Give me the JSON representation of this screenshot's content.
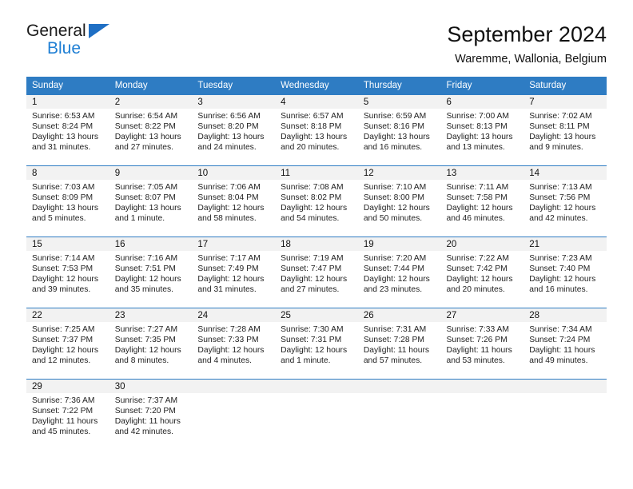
{
  "brand": {
    "name_top": "General",
    "name_bottom": "Blue",
    "accent_color": "#1f7fd4"
  },
  "header": {
    "title": "September 2024",
    "subtitle": "Waremme, Wallonia, Belgium"
  },
  "theme": {
    "header_bg": "#2e7cc3",
    "daynum_bg": "#f2f2f2",
    "text": "#222222"
  },
  "calendar": {
    "weekday_headers": [
      "Sunday",
      "Monday",
      "Tuesday",
      "Wednesday",
      "Thursday",
      "Friday",
      "Saturday"
    ],
    "weeks": [
      [
        {
          "day": "1",
          "sunrise": "Sunrise: 6:53 AM",
          "sunset": "Sunset: 8:24 PM",
          "daylight1": "Daylight: 13 hours",
          "daylight2": "and 31 minutes."
        },
        {
          "day": "2",
          "sunrise": "Sunrise: 6:54 AM",
          "sunset": "Sunset: 8:22 PM",
          "daylight1": "Daylight: 13 hours",
          "daylight2": "and 27 minutes."
        },
        {
          "day": "3",
          "sunrise": "Sunrise: 6:56 AM",
          "sunset": "Sunset: 8:20 PM",
          "daylight1": "Daylight: 13 hours",
          "daylight2": "and 24 minutes."
        },
        {
          "day": "4",
          "sunrise": "Sunrise: 6:57 AM",
          "sunset": "Sunset: 8:18 PM",
          "daylight1": "Daylight: 13 hours",
          "daylight2": "and 20 minutes."
        },
        {
          "day": "5",
          "sunrise": "Sunrise: 6:59 AM",
          "sunset": "Sunset: 8:16 PM",
          "daylight1": "Daylight: 13 hours",
          "daylight2": "and 16 minutes."
        },
        {
          "day": "6",
          "sunrise": "Sunrise: 7:00 AM",
          "sunset": "Sunset: 8:13 PM",
          "daylight1": "Daylight: 13 hours",
          "daylight2": "and 13 minutes."
        },
        {
          "day": "7",
          "sunrise": "Sunrise: 7:02 AM",
          "sunset": "Sunset: 8:11 PM",
          "daylight1": "Daylight: 13 hours",
          "daylight2": "and 9 minutes."
        }
      ],
      [
        {
          "day": "8",
          "sunrise": "Sunrise: 7:03 AM",
          "sunset": "Sunset: 8:09 PM",
          "daylight1": "Daylight: 13 hours",
          "daylight2": "and 5 minutes."
        },
        {
          "day": "9",
          "sunrise": "Sunrise: 7:05 AM",
          "sunset": "Sunset: 8:07 PM",
          "daylight1": "Daylight: 13 hours",
          "daylight2": "and 1 minute."
        },
        {
          "day": "10",
          "sunrise": "Sunrise: 7:06 AM",
          "sunset": "Sunset: 8:04 PM",
          "daylight1": "Daylight: 12 hours",
          "daylight2": "and 58 minutes."
        },
        {
          "day": "11",
          "sunrise": "Sunrise: 7:08 AM",
          "sunset": "Sunset: 8:02 PM",
          "daylight1": "Daylight: 12 hours",
          "daylight2": "and 54 minutes."
        },
        {
          "day": "12",
          "sunrise": "Sunrise: 7:10 AM",
          "sunset": "Sunset: 8:00 PM",
          "daylight1": "Daylight: 12 hours",
          "daylight2": "and 50 minutes."
        },
        {
          "day": "13",
          "sunrise": "Sunrise: 7:11 AM",
          "sunset": "Sunset: 7:58 PM",
          "daylight1": "Daylight: 12 hours",
          "daylight2": "and 46 minutes."
        },
        {
          "day": "14",
          "sunrise": "Sunrise: 7:13 AM",
          "sunset": "Sunset: 7:56 PM",
          "daylight1": "Daylight: 12 hours",
          "daylight2": "and 42 minutes."
        }
      ],
      [
        {
          "day": "15",
          "sunrise": "Sunrise: 7:14 AM",
          "sunset": "Sunset: 7:53 PM",
          "daylight1": "Daylight: 12 hours",
          "daylight2": "and 39 minutes."
        },
        {
          "day": "16",
          "sunrise": "Sunrise: 7:16 AM",
          "sunset": "Sunset: 7:51 PM",
          "daylight1": "Daylight: 12 hours",
          "daylight2": "and 35 minutes."
        },
        {
          "day": "17",
          "sunrise": "Sunrise: 7:17 AM",
          "sunset": "Sunset: 7:49 PM",
          "daylight1": "Daylight: 12 hours",
          "daylight2": "and 31 minutes."
        },
        {
          "day": "18",
          "sunrise": "Sunrise: 7:19 AM",
          "sunset": "Sunset: 7:47 PM",
          "daylight1": "Daylight: 12 hours",
          "daylight2": "and 27 minutes."
        },
        {
          "day": "19",
          "sunrise": "Sunrise: 7:20 AM",
          "sunset": "Sunset: 7:44 PM",
          "daylight1": "Daylight: 12 hours",
          "daylight2": "and 23 minutes."
        },
        {
          "day": "20",
          "sunrise": "Sunrise: 7:22 AM",
          "sunset": "Sunset: 7:42 PM",
          "daylight1": "Daylight: 12 hours",
          "daylight2": "and 20 minutes."
        },
        {
          "day": "21",
          "sunrise": "Sunrise: 7:23 AM",
          "sunset": "Sunset: 7:40 PM",
          "daylight1": "Daylight: 12 hours",
          "daylight2": "and 16 minutes."
        }
      ],
      [
        {
          "day": "22",
          "sunrise": "Sunrise: 7:25 AM",
          "sunset": "Sunset: 7:37 PM",
          "daylight1": "Daylight: 12 hours",
          "daylight2": "and 12 minutes."
        },
        {
          "day": "23",
          "sunrise": "Sunrise: 7:27 AM",
          "sunset": "Sunset: 7:35 PM",
          "daylight1": "Daylight: 12 hours",
          "daylight2": "and 8 minutes."
        },
        {
          "day": "24",
          "sunrise": "Sunrise: 7:28 AM",
          "sunset": "Sunset: 7:33 PM",
          "daylight1": "Daylight: 12 hours",
          "daylight2": "and 4 minutes."
        },
        {
          "day": "25",
          "sunrise": "Sunrise: 7:30 AM",
          "sunset": "Sunset: 7:31 PM",
          "daylight1": "Daylight: 12 hours",
          "daylight2": "and 1 minute."
        },
        {
          "day": "26",
          "sunrise": "Sunrise: 7:31 AM",
          "sunset": "Sunset: 7:28 PM",
          "daylight1": "Daylight: 11 hours",
          "daylight2": "and 57 minutes."
        },
        {
          "day": "27",
          "sunrise": "Sunrise: 7:33 AM",
          "sunset": "Sunset: 7:26 PM",
          "daylight1": "Daylight: 11 hours",
          "daylight2": "and 53 minutes."
        },
        {
          "day": "28",
          "sunrise": "Sunrise: 7:34 AM",
          "sunset": "Sunset: 7:24 PM",
          "daylight1": "Daylight: 11 hours",
          "daylight2": "and 49 minutes."
        }
      ],
      [
        {
          "day": "29",
          "sunrise": "Sunrise: 7:36 AM",
          "sunset": "Sunset: 7:22 PM",
          "daylight1": "Daylight: 11 hours",
          "daylight2": "and 45 minutes."
        },
        {
          "day": "30",
          "sunrise": "Sunrise: 7:37 AM",
          "sunset": "Sunset: 7:20 PM",
          "daylight1": "Daylight: 11 hours",
          "daylight2": "and 42 minutes."
        },
        {
          "day": "",
          "sunrise": "",
          "sunset": "",
          "daylight1": "",
          "daylight2": ""
        },
        {
          "day": "",
          "sunrise": "",
          "sunset": "",
          "daylight1": "",
          "daylight2": ""
        },
        {
          "day": "",
          "sunrise": "",
          "sunset": "",
          "daylight1": "",
          "daylight2": ""
        },
        {
          "day": "",
          "sunrise": "",
          "sunset": "",
          "daylight1": "",
          "daylight2": ""
        },
        {
          "day": "",
          "sunrise": "",
          "sunset": "",
          "daylight1": "",
          "daylight2": ""
        }
      ]
    ]
  }
}
